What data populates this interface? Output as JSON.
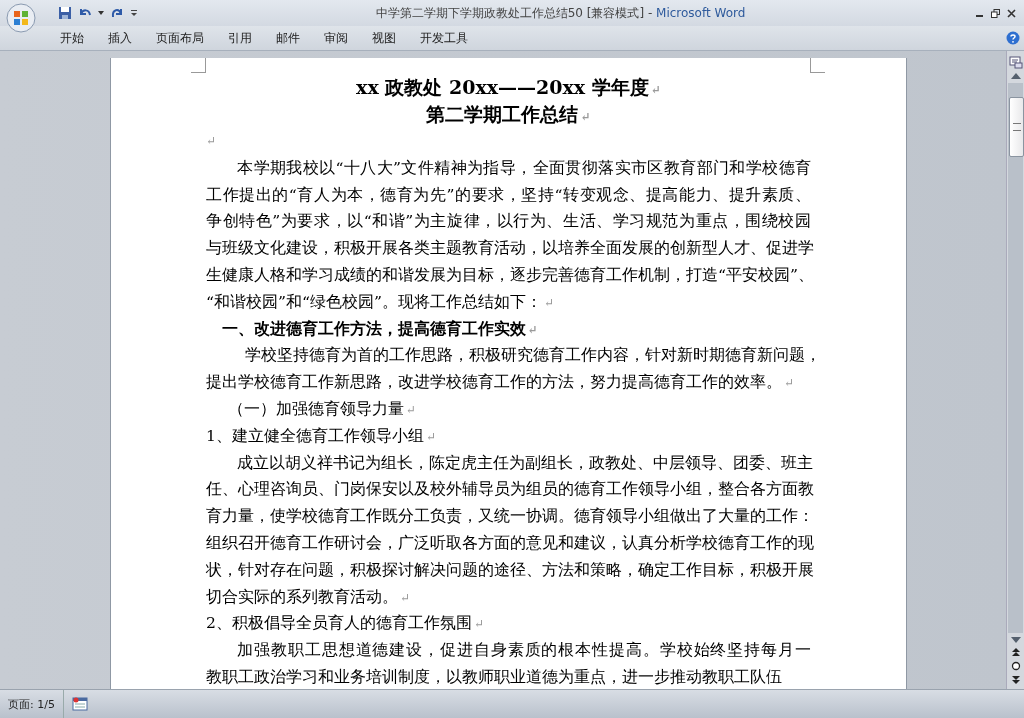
{
  "window": {
    "title": "中学第二学期下学期政教处工作总结50 [兼容模式] - ",
    "app_name": "Microsoft Word"
  },
  "tabs": [
    {
      "label": "开始",
      "selected": false
    },
    {
      "label": "插入",
      "selected": false
    },
    {
      "label": "页面布局",
      "selected": false
    },
    {
      "label": "引用",
      "selected": false
    },
    {
      "label": "邮件",
      "selected": false
    },
    {
      "label": "审阅",
      "selected": false
    },
    {
      "label": "视图",
      "selected": false
    },
    {
      "label": "开发工具",
      "selected": false
    }
  ],
  "document": {
    "para_mark": "↵",
    "paragraphs": [
      {
        "kind": "title",
        "lines": [
          "xx 政教处 20xx——20xx 学年度"
        ],
        "ended": true
      },
      {
        "kind": "title",
        "lines": [
          "第二学期工作总结"
        ],
        "ended": true
      },
      {
        "kind": "blank",
        "ended": true
      },
      {
        "kind": "body",
        "lines": [
          "本学期我校以“十八大”文件精神为指导，全面贯彻落实市区教育部门和学校德育",
          "工作提出的“育人为本，德育为先”的要求，坚持“转变观念、提高能力、提升素质、",
          "争创特色”为要求，以“和谐”为主旋律，以行为、生活、学习规范为重点，围绕校园",
          "与班级文化建设，积极开展各类主题教育活动，以培养全面发展的创新型人才、促进学",
          "生健康人格和学习成绩的和谐发展为目标，逐步完善德育工作机制，打造“平安校园”、",
          "“和谐校园”和“绿色校园”。现将工作总结如下："
        ],
        "ended": true
      },
      {
        "kind": "heading",
        "lines": [
          "一、改进德育工作方法，提高德育工作实效"
        ],
        "ended": true
      },
      {
        "kind": "body_wide",
        "lines": [
          "学校坚持德育为首的工作思路，积极研究德育工作内容，针对新时期德育新问题，",
          "提出学校德育工作新思路，改进学校德育工作的方法，努力提高德育工作的效率。"
        ],
        "ended": true
      },
      {
        "kind": "subheading",
        "lines": [
          "（一）加强德育领导力量"
        ],
        "ended": true
      },
      {
        "kind": "item",
        "lines": [
          "1、建立健全德育工作领导小组"
        ],
        "ended": true
      },
      {
        "kind": "body",
        "lines": [
          "成立以胡义祥书记为组长，陈定虎主任为副组长，政教处、中层领导、团委、班主",
          "任、心理咨询员、门岗保安以及校外辅导员为组员的德育工作领导小组，整合各方面教",
          "育力量，使学校德育工作既分工负责，又统一协调。德育领导小组做出了大量的工作：",
          "组织召开德育工作研讨会，广泛听取各方面的意见和建议，认真分析学校德育工作的现",
          "状，针对存在问题，积极探讨解决问题的途径、方法和策略，确定工作目标，积极开展",
          "切合实际的系列教育活动。"
        ],
        "ended": true
      },
      {
        "kind": "item",
        "lines": [
          "2、积极倡导全员育人的德育工作氛围"
        ],
        "ended": true
      },
      {
        "kind": "body",
        "lines": [
          "加强教职工思想道德建设，促进自身素质的根本性提高。学校始终坚持每月一",
          "教职工政治学习和业务培训制度，以教师职业道德为重点，进一步推动教职工队伍"
        ],
        "ended": false
      }
    ]
  },
  "status_bar": {
    "page": "页面: 1/5"
  }
}
